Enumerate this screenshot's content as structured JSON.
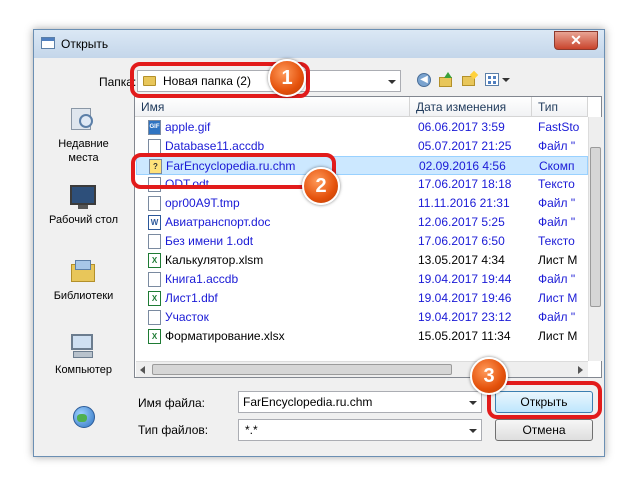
{
  "window": {
    "title": "Открыть",
    "close_glyph": "✕"
  },
  "toolbar": {
    "folder_label": "Папка:",
    "folder_value": "Новая папка (2)"
  },
  "places": [
    {
      "label_line1": "Недавние",
      "label_line2": "места",
      "icon": "recent-places-icon"
    },
    {
      "label_line1": "Рабочий стол",
      "label_line2": "",
      "icon": "desktop-icon"
    },
    {
      "label_line1": "Библиотеки",
      "label_line2": "",
      "icon": "libraries-icon"
    },
    {
      "label_line1": "Компьютер",
      "label_line2": "",
      "icon": "computer-icon"
    }
  ],
  "columns": {
    "name": "Имя",
    "date": "Дата изменения",
    "type": "Тип"
  },
  "files": [
    {
      "name": "apple.gif",
      "date": "06.06.2017 3:59",
      "type": "FastSto",
      "icon": "GIF",
      "color": "blue"
    },
    {
      "name": "Database11.accdb",
      "date": "05.07.2017 21:25",
      "type": "Файл \"",
      "icon": "",
      "color": "blue"
    },
    {
      "name": "FarEncyclopedia.ru.chm",
      "date": "02.09.2016 4:56",
      "type": "Скомп",
      "icon": "?",
      "color": "blue"
    },
    {
      "name": "ODT.odt",
      "date": "17.06.2017 18:18",
      "type": "Тексто",
      "icon": "",
      "color": "blue"
    },
    {
      "name": "opr00A9T.tmp",
      "date": "11.11.2016 21:31",
      "type": "Файл \"",
      "icon": "",
      "color": "blue"
    },
    {
      "name": "Авиатранспорт.doc",
      "date": "12.06.2017 5:25",
      "type": "Файл \"",
      "icon": "W",
      "color": "blue"
    },
    {
      "name": "Без имени 1.odt",
      "date": "17.06.2017 6:50",
      "type": "Тексто",
      "icon": "",
      "color": "blue"
    },
    {
      "name": "Калькулятор.xlsm",
      "date": "13.05.2017 4:34",
      "type": "Лист М",
      "icon": "X",
      "color": "black"
    },
    {
      "name": "Книга1.accdb",
      "date": "19.04.2017 19:44",
      "type": "Файл \"",
      "icon": "",
      "color": "blue"
    },
    {
      "name": "Лист1.dbf",
      "date": "19.04.2017 19:46",
      "type": "Лист М",
      "icon": "X",
      "color": "blue"
    },
    {
      "name": "Участок",
      "date": "19.04.2017 23:12",
      "type": "Файл \"",
      "icon": "",
      "color": "blue"
    },
    {
      "name": "Форматирование.xlsx",
      "date": "15.05.2017 11:34",
      "type": "Лист М",
      "icon": "X",
      "color": "black"
    }
  ],
  "form": {
    "filename_label": "Имя файла:",
    "filename_value": "FarEncyclopedia.ru.chm",
    "filetype_label": "Тип файлов:",
    "filetype_value": "*.*",
    "open_button": "Открыть",
    "cancel_button": "Отмена"
  },
  "annotations": {
    "badge1": "1",
    "badge2": "2",
    "badge3": "3",
    "color": "#e21b1b",
    "badge_color": "#e4510b"
  },
  "colors": {
    "selection": "#cce8ff",
    "link_text": "#1a1ad6"
  }
}
